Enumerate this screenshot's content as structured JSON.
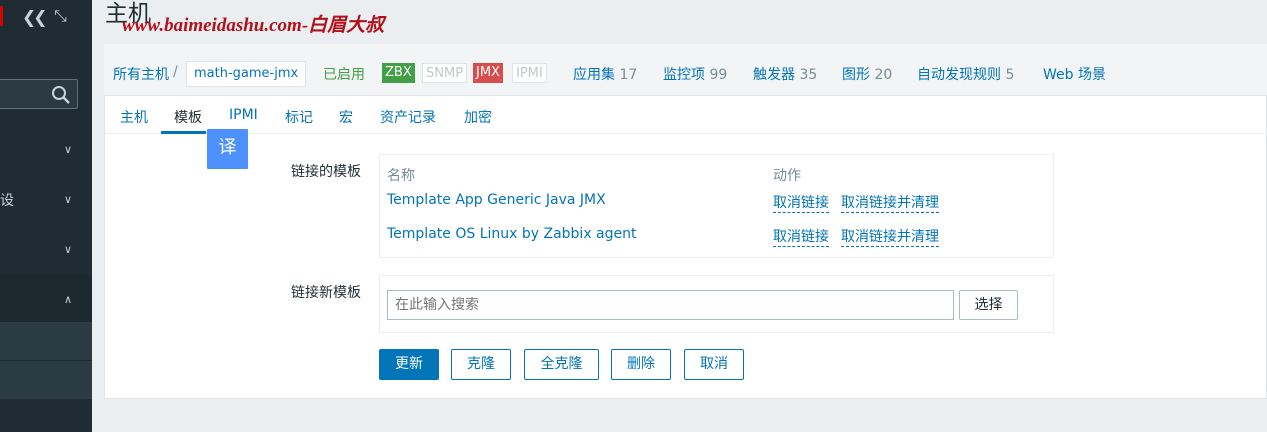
{
  "page": {
    "title": "主机",
    "watermark": "www.baimeidashu.com-白眉大叔"
  },
  "sidebar": {
    "partial_label": "设",
    "icons": [
      "collapse-icon",
      "expand-icon",
      "search-icon",
      "chevron-down-icon",
      "chevron-up-icon"
    ]
  },
  "hostbar": {
    "breadcrumb_root": "所有主机",
    "separator": "/",
    "current_host": "math-game-jmx",
    "status": "已启用",
    "badges": {
      "zbx": "ZBX",
      "snmp": "SNMP",
      "jmx": "JMX",
      "ipmi": "IPMI"
    },
    "links": [
      {
        "label": "应用集",
        "count": "17"
      },
      {
        "label": "监控项",
        "count": "99"
      },
      {
        "label": "触发器",
        "count": "35"
      },
      {
        "label": "图形",
        "count": "20"
      },
      {
        "label": "自动发现规则",
        "count": "5"
      },
      {
        "label": "Web 场景",
        "count": ""
      }
    ]
  },
  "tabs": [
    "主机",
    "模板",
    "IPMI",
    "标记",
    "宏",
    "资产记录",
    "加密"
  ],
  "translate_button": "译",
  "linked_templates": {
    "label": "链接的模板",
    "headers": {
      "name": "名称",
      "action": "动作"
    },
    "rows": [
      {
        "name": "Template App Generic Java JMX",
        "unlink": "取消链接",
        "unlink_clear": "取消链接并清理"
      },
      {
        "name": "Template OS Linux by Zabbix agent",
        "unlink": "取消链接",
        "unlink_clear": "取消链接并清理"
      }
    ]
  },
  "link_new": {
    "label": "链接新模板",
    "placeholder": "在此输入搜索",
    "select_label": "选择"
  },
  "buttons": {
    "update": "更新",
    "clone": "克隆",
    "full_clone": "全克隆",
    "delete": "删除",
    "cancel": "取消"
  },
  "colors": {
    "accent": "#0275b8",
    "sidebar": "#1f2c33",
    "enabled": "#429e47",
    "jmx": "#d64e4e"
  }
}
